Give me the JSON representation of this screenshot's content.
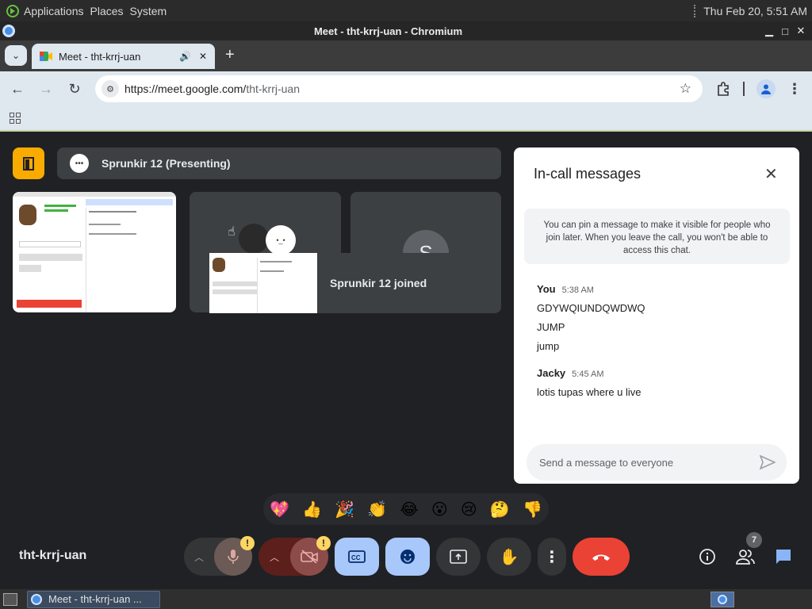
{
  "system_bar": {
    "menus": [
      "Applications",
      "Places",
      "System"
    ],
    "clock": "Thu Feb 20,  5:51 AM"
  },
  "window": {
    "title": "Meet - tht-krrj-uan - Chromium"
  },
  "browser": {
    "tab_title": "Meet - tht-krrj-uan",
    "new_tab": "+",
    "url_prefix": "https://meet.google.com/",
    "url_path": "tht-krrj-uan"
  },
  "presenting": {
    "name": "Sprunkir 12 (Presenting)"
  },
  "tiles": {
    "joined_notice": "Sprunkir 12 joined",
    "avatar_letter": "S"
  },
  "chat": {
    "title": "In-call messages",
    "pin_notice": "You can pin a message to make it visible for people who join later. When you leave the call, you won't be able to access this chat.",
    "groups": [
      {
        "sender": "You",
        "time": "5:38 AM",
        "messages": [
          "GDYWQIUNDQWDWQ",
          "JUMP",
          "jump"
        ]
      },
      {
        "sender": "Jacky",
        "time": "5:45 AM",
        "messages": [
          "lotis tupas where u live"
        ]
      }
    ],
    "input_placeholder": "Send a message to everyone"
  },
  "reactions": [
    "💖",
    "👍",
    "🎉",
    "👏",
    "😂",
    "😮",
    "😢",
    "🤔",
    "👎"
  ],
  "controls": {
    "meeting_code": "tht-krrj-uan",
    "participants_badge": "7",
    "mic_warning": "!",
    "cam_warning": "!"
  },
  "taskbar": {
    "window_label": "Meet - tht-krrj-uan ..."
  },
  "colors": {
    "meet_bg": "#202124",
    "tile": "#3c4043",
    "end_call": "#ea4335",
    "accent_blue": "#a8c7fa",
    "warning_yellow": "#fdd663"
  }
}
